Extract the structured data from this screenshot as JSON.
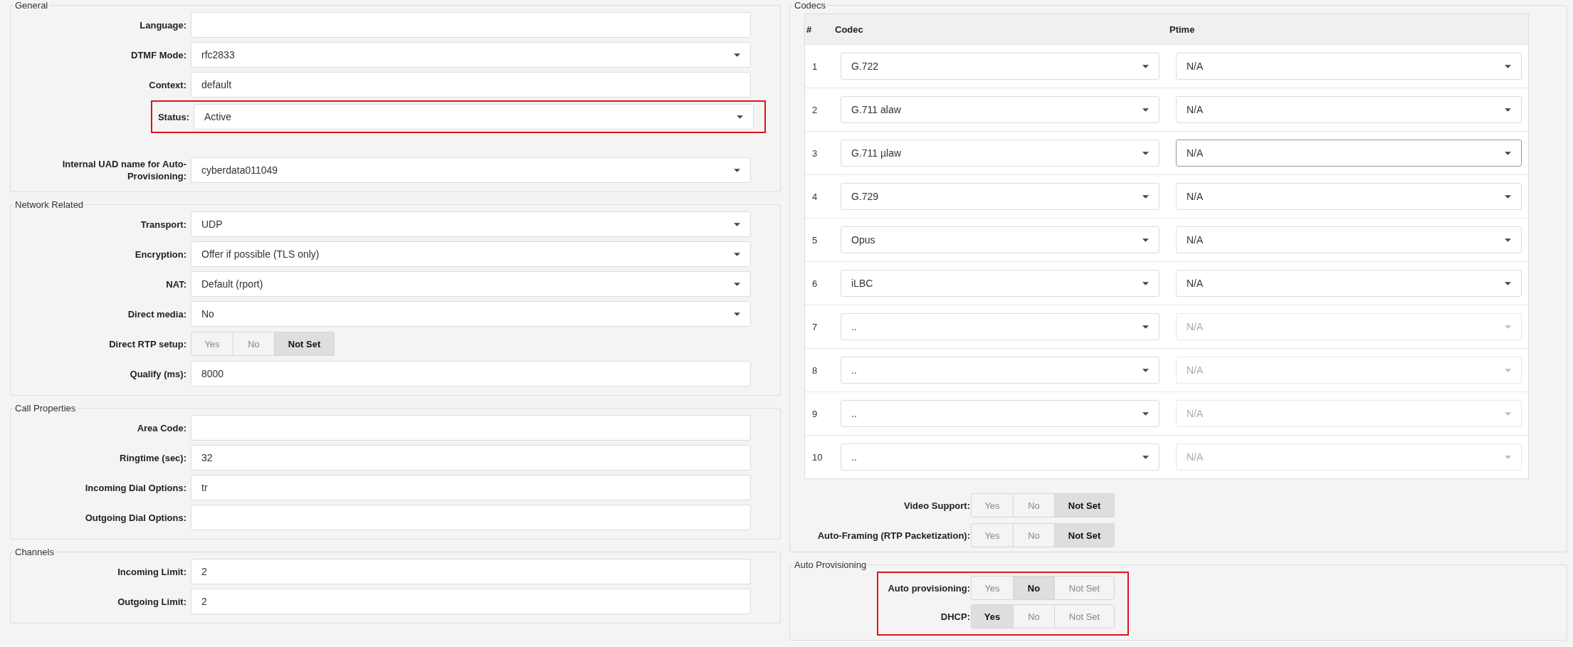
{
  "left_sections": [
    {
      "title": "General",
      "rows": [
        {
          "kind": "text",
          "label": "Language:"
        },
        {
          "kind": "select",
          "label": "DTMF Mode:",
          "value": "rfc2833"
        },
        {
          "kind": "text",
          "label": "Context:",
          "value": "default"
        },
        {
          "kind": "select",
          "label": "Status:",
          "value": "Active",
          "highlighted": true
        },
        {
          "kind": "select",
          "label": "Internal UAD name for Auto-Provisioning:",
          "value": "cyberdata011049"
        }
      ]
    },
    {
      "title": "Network Related",
      "rows": [
        {
          "kind": "select",
          "label": "Transport:",
          "value": "UDP"
        },
        {
          "kind": "select",
          "label": "Encryption:",
          "value": "Offer if possible (TLS only)"
        },
        {
          "kind": "select",
          "label": "NAT:",
          "value": "Default (rport)"
        },
        {
          "kind": "select",
          "label": "Direct media:",
          "value": "No"
        },
        {
          "kind": "toggle",
          "label": "Direct RTP setup:",
          "options": [
            {
              "label": "Yes",
              "selected": false
            },
            {
              "label": "No",
              "selected": false
            },
            {
              "label": "Not Set",
              "selected": true
            }
          ]
        },
        {
          "kind": "text",
          "label": "Qualify (ms):",
          "value": "8000"
        }
      ]
    },
    {
      "title": "Call Properties",
      "rows": [
        {
          "kind": "text",
          "label": "Area Code:"
        },
        {
          "kind": "text",
          "label": "Ringtime (sec):",
          "value": "32"
        },
        {
          "kind": "text",
          "label": "Incoming Dial Options:",
          "value": "tr"
        },
        {
          "kind": "text",
          "label": "Outgoing Dial Options:"
        }
      ]
    },
    {
      "title": "Channels",
      "rows": [
        {
          "kind": "text",
          "label": "Incoming Limit:",
          "value": "2"
        },
        {
          "kind": "text",
          "label": "Outgoing Limit:",
          "value": "2"
        }
      ]
    }
  ],
  "codecs": {
    "title": "Codecs",
    "columns": [
      "#",
      "Codec",
      "Ptime"
    ],
    "rows": [
      {
        "number": "1",
        "codec": "G.722",
        "ptime": "N/A",
        "ptime_disabled": false,
        "ptime_focused": false
      },
      {
        "number": "2",
        "codec": "G.711 alaw",
        "ptime": "N/A",
        "ptime_disabled": false,
        "ptime_focused": false
      },
      {
        "number": "3",
        "codec": "G.711 µlaw",
        "ptime": "N/A",
        "ptime_disabled": false,
        "ptime_focused": true
      },
      {
        "number": "4",
        "codec": "G.729",
        "ptime": "N/A",
        "ptime_disabled": false,
        "ptime_focused": false
      },
      {
        "number": "5",
        "codec": "Opus",
        "ptime": "N/A",
        "ptime_disabled": false,
        "ptime_focused": false
      },
      {
        "number": "6",
        "codec": "iLBC",
        "ptime": "N/A",
        "ptime_disabled": false,
        "ptime_focused": false
      },
      {
        "number": "7",
        "codec": "..",
        "ptime": "N/A",
        "ptime_disabled": true,
        "ptime_focused": false
      },
      {
        "number": "8",
        "codec": "..",
        "ptime": "N/A",
        "ptime_disabled": true,
        "ptime_focused": false
      },
      {
        "number": "9",
        "codec": "..",
        "ptime": "N/A",
        "ptime_disabled": true,
        "ptime_focused": false
      },
      {
        "number": "10",
        "codec": "..",
        "ptime": "N/A",
        "ptime_disabled": true,
        "ptime_focused": false
      }
    ],
    "toggles": [
      {
        "label": "Video Support:",
        "options": [
          {
            "label": "Yes",
            "selected": false
          },
          {
            "label": "No",
            "selected": false
          },
          {
            "label": "Not Set",
            "selected": true
          }
        ]
      },
      {
        "label": "Auto-Framing (RTP Packetization):",
        "options": [
          {
            "label": "Yes",
            "selected": false
          },
          {
            "label": "No",
            "selected": false
          },
          {
            "label": "Not Set",
            "selected": true
          }
        ]
      }
    ]
  },
  "auto_provisioning": {
    "title": "Auto Provisioning",
    "highlighted": true,
    "toggles": [
      {
        "label": "Auto provisioning:",
        "options": [
          {
            "label": "Yes",
            "selected": false
          },
          {
            "label": "No",
            "selected": true
          },
          {
            "label": "Not Set",
            "selected": false
          }
        ]
      },
      {
        "label": "DHCP:",
        "options": [
          {
            "label": "Yes",
            "selected": true
          },
          {
            "label": "No",
            "selected": false
          },
          {
            "label": "Not Set",
            "selected": false
          }
        ]
      }
    ]
  }
}
